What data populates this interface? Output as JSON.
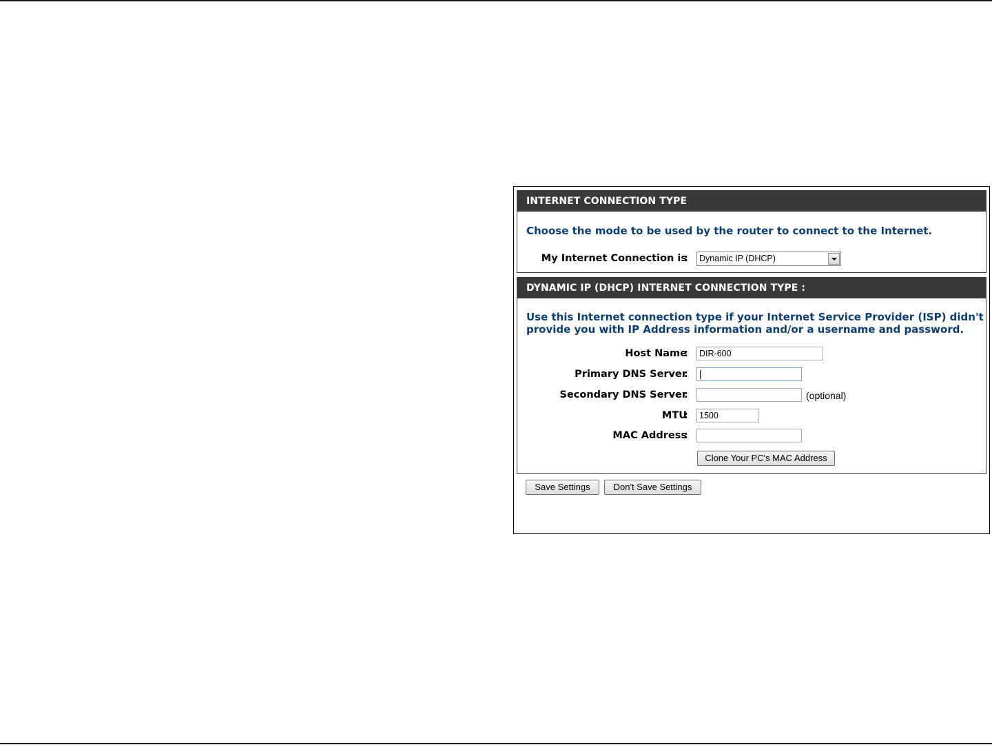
{
  "connection_type": {
    "header": "INTERNET CONNECTION TYPE",
    "description": "Choose the mode to be used by the router to connect to the Internet.",
    "mode_label": "My Internet Connection is",
    "mode_value": "Dynamic IP (DHCP)"
  },
  "dhcp": {
    "header": "DYNAMIC IP (DHCP) INTERNET CONNECTION TYPE :",
    "description_line1": "Use this Internet connection type if your Internet Service Provider (ISP) didn't",
    "description_line2": "provide you with IP Address information and/or a username and password.",
    "host_name_label": "Host Name",
    "host_name_value": "DIR-600",
    "primary_dns_label": "Primary DNS Server",
    "primary_dns_value": "",
    "secondary_dns_label": "Secondary DNS Server",
    "secondary_dns_value": "",
    "secondary_dns_hint": "(optional)",
    "mtu_label": "MTU",
    "mtu_value": "1500",
    "mac_label": "MAC Address",
    "mac_value": "",
    "clone_button": "Clone Your PC's MAC Address",
    "colon": ":"
  },
  "actions": {
    "save": "Save Settings",
    "dont_save": "Don't Save Settings"
  }
}
